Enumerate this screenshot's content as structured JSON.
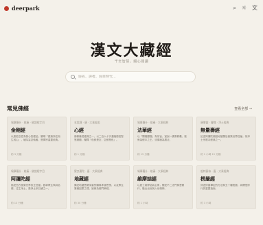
{
  "header": {
    "brand": "deerpark",
    "icons": [
      "search-icon",
      "sun-icon",
      "translate-icon"
    ]
  },
  "hero": {
    "title": "漢文大藏經",
    "subtitle": "千年智慧，觸心閱讀",
    "search_placeholder": "經名、譯者、經目時代..."
  },
  "section": {
    "title": "常見佛經",
    "see_all": "查看全部 →"
  },
  "cards": [
    {
      "meta": "鳩摩羅什 · 姚秦 · 佛說經字目",
      "title": "金剛經",
      "desc": "以般若空性為核心的經品，闡明「應無所住而生其心」，破除妄念執著，是禪宗重要依典。",
      "foot": "約 3 分鐘"
    },
    {
      "meta": "玄奘譯 · 唐 · 大乘般若",
      "title": "心經",
      "desc": "佛教最短經典之一，以二百六十字濃縮般若智慧精髓，闡釋「色即是空，空即是色」。",
      "foot": "約 1 分鐘"
    },
    {
      "meta": "鳩摩羅什 · 姚秦 · 大乘經典",
      "title": "法華經",
      "desc": "以「開權顯實」為宗旨，宣說一佛乘教義，被譽為經中之王，流傳極為廣泛。",
      "foot": "約 15 分鐘"
    },
    {
      "meta": "康僧鎧 · 曹魏 · 淨土經典",
      "title": "無量壽經",
      "desc": "記述阿彌陀佛因地發願及極樂世界莊嚴，為淨土宗根本經典之一。",
      "foot": "約 1 小時 15 分鐘"
    },
    {
      "meta": "鳩摩羅什 · 姚秦 · 佛說經字目",
      "title": "阿彌陀經",
      "desc": "描述西方極樂世界依正莊嚴，勸導眾生執持名號，往生淨土，是淨土宗日誦之一。",
      "foot": "約 13 分鐘"
    },
    {
      "meta": "實叉難陀 · 唐 · 大乘經典",
      "title": "地藏經",
      "desc": "講述地藏菩薩深重誓願與孝道思想，以及眾生業報因果之理，被譽為佛門孝經。",
      "foot": "約 30 分鐘"
    },
    {
      "meta": "鳩摩羅什 · 姚秦 · 大乘經典",
      "title": "維摩詰經",
      "desc": "以居士維摩詰為主角，闡述不二法門與菩薩行，融合出世與入世精神。",
      "foot": "約 1 小時"
    },
    {
      "meta": "般刺蜜帝 · 唐 · 大乘經典",
      "title": "楞嚴經",
      "desc": "詳述修習禪定的方法與五十種陰魔，為開悟修行的重要指南。",
      "foot": "約 3 小時"
    }
  ]
}
